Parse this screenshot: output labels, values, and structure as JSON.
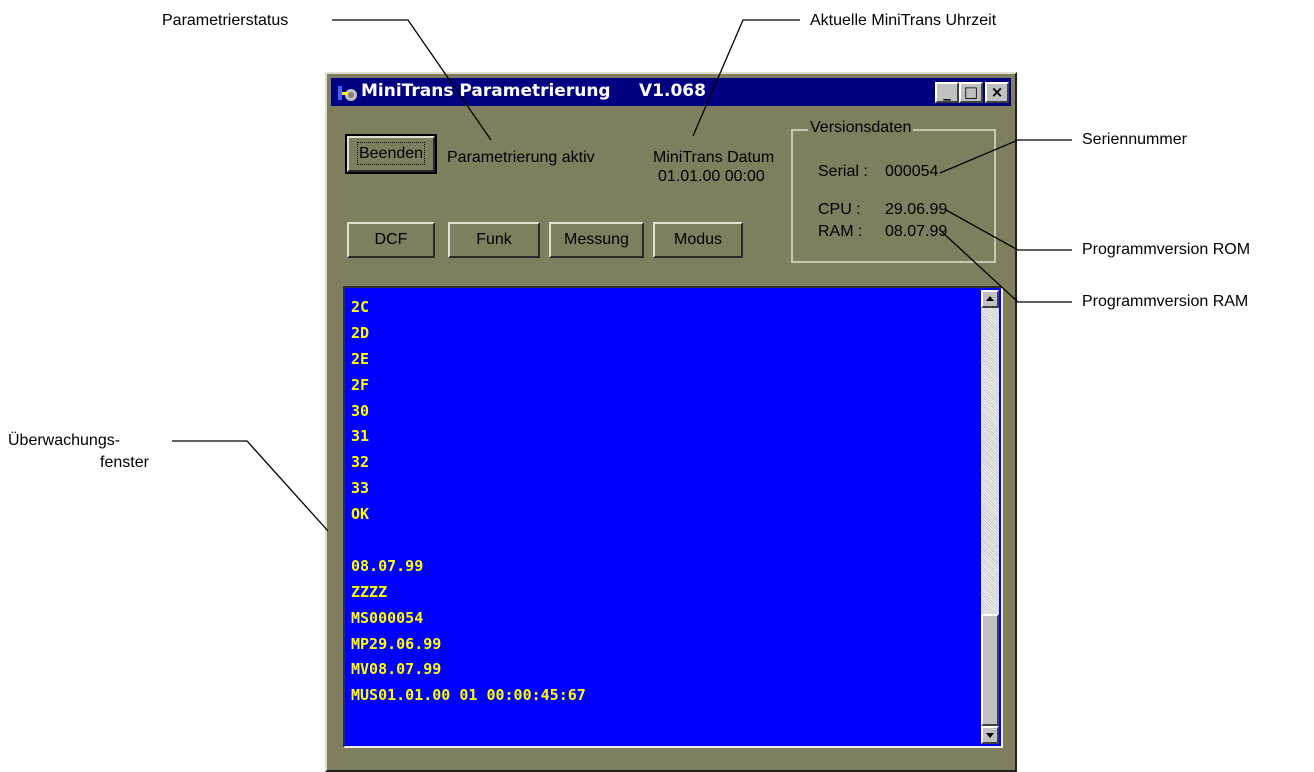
{
  "callouts": {
    "param_status": "Parametrierstatus",
    "clock": "Aktuelle MiniTrans Uhrzeit",
    "serial": "Seriennummer",
    "rom": "Programmversion ROM",
    "ram": "Programmversion RAM",
    "monitor_line1": "Überwachungs-",
    "monitor_line2": "fenster"
  },
  "window": {
    "title": "MiniTrans Parametrierung",
    "version": "V1.068",
    "icon": "app-icon",
    "controls": {
      "minimize": "_",
      "maximize": "□",
      "close": "×"
    }
  },
  "toolbar": {
    "exit_label": "Beenden",
    "status_text": "Parametrierung aktiv",
    "date_label": "MiniTrans Datum",
    "date_value": "01.01.00 00:00"
  },
  "buttons": {
    "dcf": "DCF",
    "funk": "Funk",
    "messung": "Messung",
    "modus": "Modus"
  },
  "version_group": {
    "title": "Versionsdaten",
    "serial_label": "Serial :",
    "serial_value": "000054",
    "cpu_label": "CPU :",
    "cpu_value": "29.06.99",
    "ram_label": "RAM :",
    "ram_value": "08.07.99"
  },
  "monitor": {
    "lines": [
      "2C",
      "2D",
      "2E",
      "2F",
      "30",
      "31",
      "32",
      "33",
      "OK",
      "",
      "08.07.99",
      "ZZZZ",
      "MS000054",
      "MP29.06.99",
      "MV08.07.99",
      "MUS01.01.00 01 00:00:45:67"
    ]
  },
  "colors": {
    "titlebar": "#000080",
    "window_face": "#7f7f5f",
    "monitor_bg": "#0000ff",
    "monitor_text": "#ffff00"
  }
}
